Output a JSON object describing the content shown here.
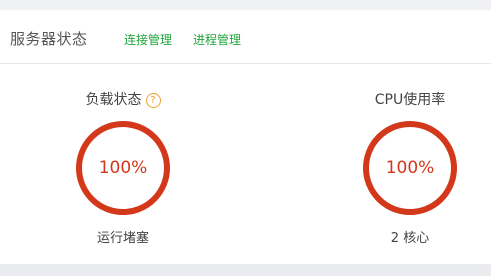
{
  "header": {
    "title": "服务器状态",
    "tabs": [
      "连接管理",
      "进程管理"
    ]
  },
  "metrics": {
    "load": {
      "label": "负载状态",
      "help_icon": "?",
      "percent": 100,
      "value_text": "100%",
      "status": "运行堵塞"
    },
    "cpu": {
      "label": "CPU使用率",
      "percent": 100,
      "value_text": "100%",
      "cores": "2 核心"
    }
  },
  "colors": {
    "gauge_full": "#d4381a",
    "accent_green": "#20a53a",
    "help_orange": "#f0a030"
  }
}
